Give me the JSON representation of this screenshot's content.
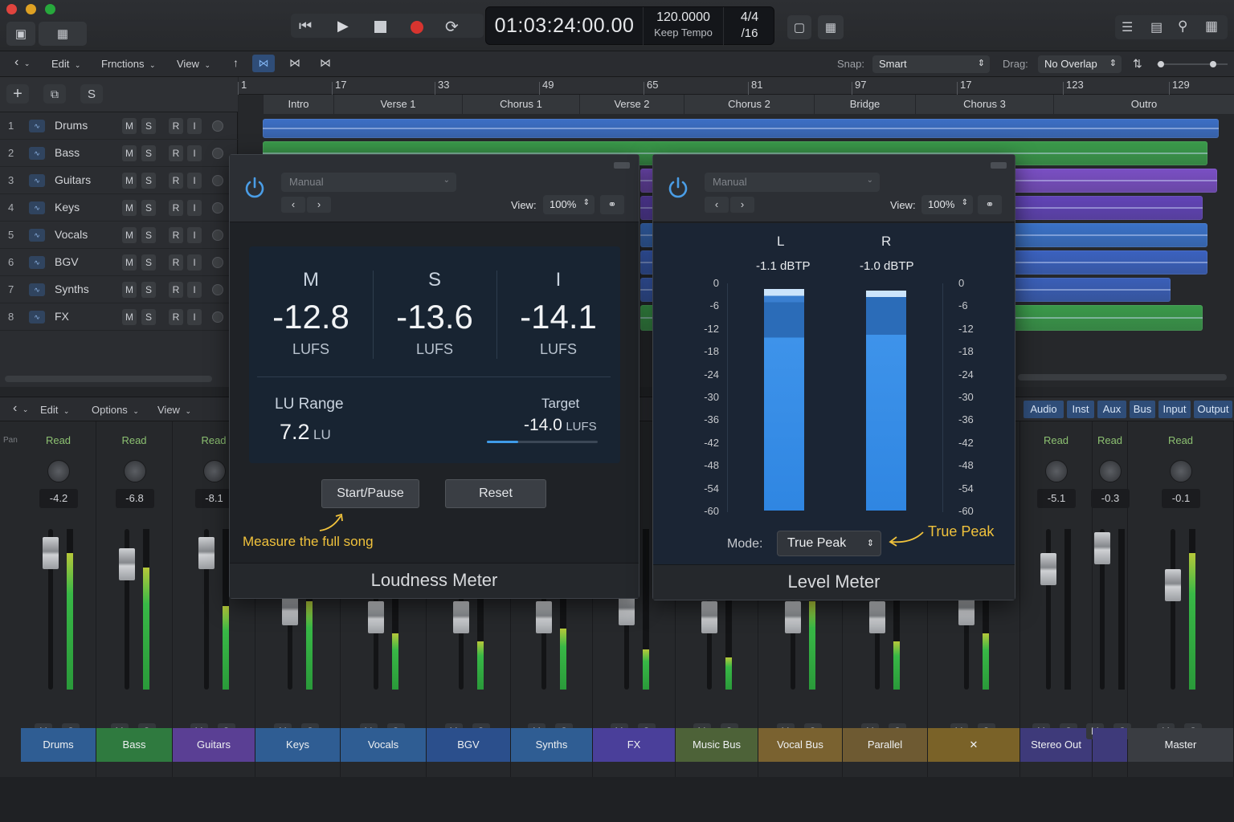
{
  "transport": {
    "timecode": "01:03:24:00.00",
    "tempo": "120.0000",
    "tempo_mode": "Keep Tempo",
    "sig_top": "4/4",
    "sig_bottom": "/16"
  },
  "ctrlbar": {
    "back": "‹",
    "edit": "Edit",
    "functions": "Frnctions",
    "view": "View",
    "snap_label": "Snap:",
    "snap_value": "Smart",
    "drag_label": "Drag:",
    "drag_value": "No Overlap"
  },
  "trackhdr": {
    "add": "+",
    "dup": "⧉",
    "solo": "S"
  },
  "tracks": [
    {
      "num": "1",
      "name": "Drums",
      "m": "M",
      "s": "S",
      "r": "R",
      "i": "I"
    },
    {
      "num": "2",
      "name": "Bass",
      "m": "M",
      "s": "S",
      "r": "R",
      "i": "I"
    },
    {
      "num": "3",
      "name": "Guitars",
      "m": "M",
      "s": "S",
      "r": "R",
      "i": "I"
    },
    {
      "num": "4",
      "name": "Keys",
      "m": "M",
      "s": "S",
      "r": "R",
      "i": "I"
    },
    {
      "num": "5",
      "name": "Vocals",
      "m": "M",
      "s": "S",
      "r": "R",
      "i": "I"
    },
    {
      "num": "6",
      "name": "BGV",
      "m": "M",
      "s": "S",
      "r": "R",
      "i": "I"
    },
    {
      "num": "7",
      "name": "Synths",
      "m": "M",
      "s": "S",
      "r": "R",
      "i": "I"
    },
    {
      "num": "8",
      "name": "FX",
      "m": "M",
      "s": "S",
      "r": "R",
      "i": "I"
    }
  ],
  "ruler": [
    "1",
    "17",
    "33",
    "49",
    "65",
    "81",
    "97",
    "17",
    "123",
    "129"
  ],
  "markers": [
    "Intro",
    "Verse 1",
    "Chorus 1",
    "Verse 2",
    "Chorus 2",
    "Bridge",
    "Chorus 3",
    "Outro"
  ],
  "mixhdr": {
    "back": "‹",
    "edit": "Edit",
    "options": "Options",
    "view": "View",
    "pan": "Pan",
    "filters": [
      "Audio",
      "Inst",
      "Aux",
      "Bus",
      "Input",
      "Output"
    ]
  },
  "strips": [
    {
      "name": "Drums",
      "read": "Read",
      "val": "-4.2",
      "m": "M",
      "s": "S",
      "fader": 0.85,
      "meter": 0.85,
      "color": "#2f5d93"
    },
    {
      "name": "Bass",
      "read": "Read",
      "val": "-6.8",
      "m": "M",
      "s": "S",
      "fader": 0.78,
      "meter": 0.76,
      "color": "#2f7a3f"
    },
    {
      "name": "Guitars",
      "read": "Read",
      "val": "-8.1",
      "m": "M",
      "s": "S",
      "fader": 0.85,
      "meter": 0.52,
      "color": "#5a3f94"
    },
    {
      "name": "Keys",
      "read": "",
      "val": "",
      "m": "M",
      "s": "S",
      "fader": 0.5,
      "meter": 0.55,
      "color": "#2f5d93"
    },
    {
      "name": "Vocals",
      "read": "",
      "val": "",
      "m": "M",
      "s": "S",
      "fader": 0.45,
      "meter": 0.35,
      "color": "#2f5d93"
    },
    {
      "name": "BGV",
      "read": "",
      "val": "",
      "m": "M",
      "s": "S",
      "fader": 0.45,
      "meter": 0.3,
      "color": "#2b4f8c"
    },
    {
      "name": "Synths",
      "read": "",
      "val": "",
      "m": "M",
      "s": "S",
      "fader": 0.45,
      "meter": 0.38,
      "color": "#2f5d93"
    },
    {
      "name": "FX",
      "read": "",
      "val": "",
      "m": "M",
      "s": "S",
      "fader": 0.5,
      "meter": 0.25,
      "color": "#4a3f9a"
    },
    {
      "name": "Music Bus",
      "read": "",
      "val": "",
      "m": "M",
      "s": "S",
      "fader": 0.45,
      "meter": 0.2,
      "color": "#4d6238"
    },
    {
      "name": "Vocal Bus",
      "read": "",
      "val": "",
      "m": "M",
      "s": "S",
      "fader": 0.45,
      "meter": 0.55,
      "color": "#7a6230"
    },
    {
      "name": "Parallel",
      "read": "",
      "val": "",
      "m": "M",
      "s": "S",
      "fader": 0.45,
      "meter": 0.3,
      "color": "#6e5a32"
    },
    {
      "name": "✕",
      "read": "",
      "val": "",
      "m": "M",
      "s": "S",
      "fader": 0.5,
      "meter": 0.35,
      "color": "#7a6228"
    },
    {
      "name": "Stereo Out",
      "read": "Read",
      "val": "-5.1",
      "m": "M",
      "s": "S",
      "fader": 0.75,
      "meter": 0,
      "color": "#3e3a7a"
    },
    {
      "name": "",
      "read": "Read",
      "val": "-0.3",
      "m": "M",
      "s": "S",
      "fader": 0.88,
      "meter": 0,
      "color": "#3e3a7a"
    },
    {
      "name": "Master",
      "read": "Read",
      "val": "-0.1",
      "m": "M",
      "s": "S",
      "fader": 0.65,
      "meter": 0.85,
      "color": "#3a3d42"
    }
  ],
  "loudness": {
    "preset": "Manual",
    "view_label": "View:",
    "zoom": "100%",
    "m_label": "M",
    "m_value": "-12.8",
    "m_unit": "LUFS",
    "s_label": "S",
    "s_value": "-13.6",
    "s_unit": "LUFS",
    "i_label": "I",
    "i_value": "-14.1",
    "i_unit": "LUFS",
    "range_label": "LU Range",
    "range_value": "7.2",
    "range_unit": "LU",
    "target_label": "Target",
    "target_value": "-14.0",
    "target_unit": "LUFS",
    "start": "Start/Pause",
    "reset": "Reset",
    "note": "Measure the full song",
    "title": "Loudness Meter"
  },
  "level": {
    "preset": "Manual",
    "view_label": "View:",
    "zoom": "100%",
    "l_label": "L",
    "r_label": "R",
    "l_peak": "-1.1 dBTP",
    "r_peak": "-1.0 dBTP",
    "scale": [
      "0",
      "-6",
      "-12",
      "-18",
      "-24",
      "-30",
      "-36",
      "-42",
      "-48",
      "-54",
      "-60"
    ],
    "mode_label": "Mode:",
    "mode_value": "True Peak",
    "note": "True Peak",
    "title": "Level Meter"
  }
}
